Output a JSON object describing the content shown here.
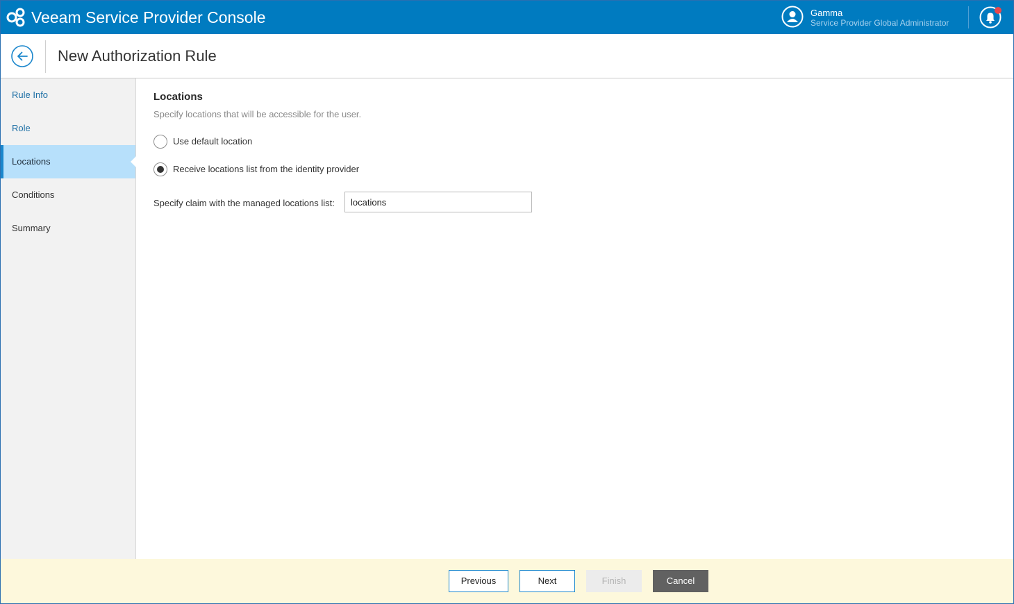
{
  "app": {
    "title": "Veeam Service Provider Console",
    "brand_color": "#007bc0"
  },
  "user": {
    "name": "Gamma",
    "role": "Service Provider Global Administrator",
    "avatar_icon": "user-icon",
    "notification_icon": "bell-icon",
    "has_notifications": true
  },
  "header": {
    "title": "New Authorization Rule",
    "back_icon": "arrow-left-icon"
  },
  "steps": [
    {
      "label": "Rule Info",
      "state": "done"
    },
    {
      "label": "Role",
      "state": "done"
    },
    {
      "label": "Locations",
      "state": "active"
    },
    {
      "label": "Conditions",
      "state": "todo"
    },
    {
      "label": "Summary",
      "state": "todo"
    }
  ],
  "content": {
    "title": "Locations",
    "description": "Specify locations that will be accessible for the user.",
    "options": [
      {
        "label": "Use default location",
        "selected": false
      },
      {
        "label": "Receive locations list from the identity provider",
        "selected": true
      }
    ],
    "claim_label": "Specify claim with the managed locations list:",
    "claim_value": "locations"
  },
  "footer": {
    "previous": "Previous",
    "next": "Next",
    "finish": "Finish",
    "cancel": "Cancel"
  }
}
